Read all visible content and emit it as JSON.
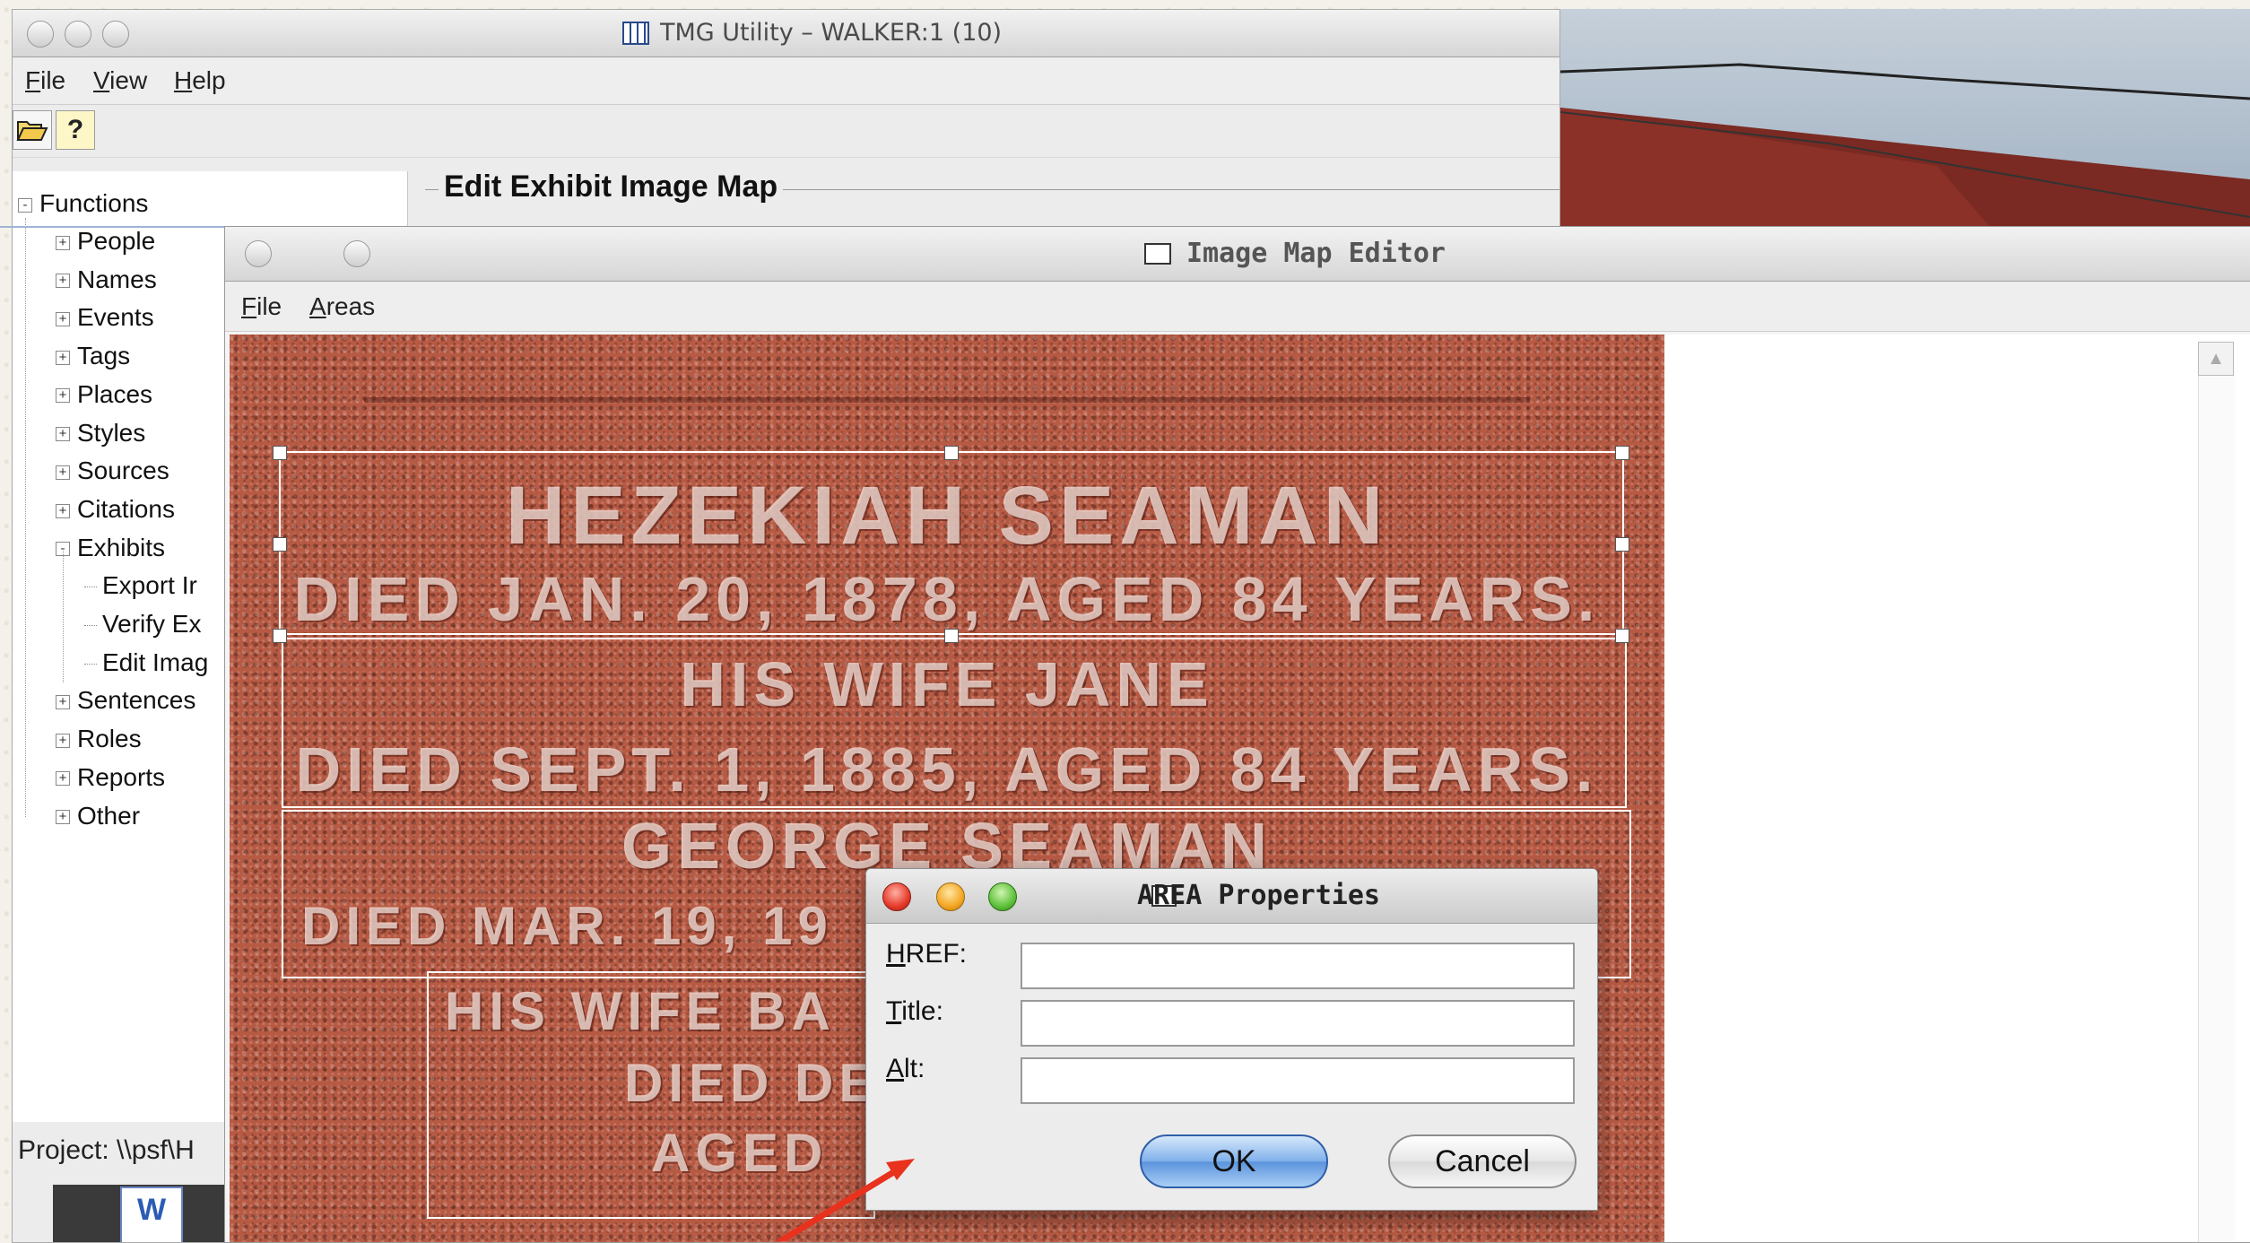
{
  "tmg_window": {
    "title": "TMG Utility – WALKER:1 (10)",
    "menu": [
      "File",
      "View",
      "Help"
    ],
    "menu_underline": [
      "F",
      "V",
      "H"
    ],
    "toolbar_icons": [
      "open-folder-icon",
      "help-icon"
    ]
  },
  "tree": {
    "root": "Functions",
    "items": [
      {
        "label": "People",
        "expander": "+"
      },
      {
        "label": "Names",
        "expander": "+"
      },
      {
        "label": "Events",
        "expander": "+"
      },
      {
        "label": "Tags",
        "expander": "+"
      },
      {
        "label": "Places",
        "expander": "+"
      },
      {
        "label": "Styles",
        "expander": "+"
      },
      {
        "label": "Sources",
        "expander": "+"
      },
      {
        "label": "Citations",
        "expander": "+"
      },
      {
        "label": "Exhibits",
        "expander": "-"
      },
      {
        "label": "Export Ir",
        "expander": ""
      },
      {
        "label": "Verify Ex",
        "expander": ""
      },
      {
        "label": "Edit Imag",
        "expander": ""
      },
      {
        "label": "Sentences",
        "expander": "+"
      },
      {
        "label": "Roles",
        "expander": "+"
      },
      {
        "label": "Reports",
        "expander": "+"
      },
      {
        "label": "Other",
        "expander": "+"
      }
    ],
    "root_expander": "-"
  },
  "project_label": "Project: \\\\psf\\H",
  "group_title": "Edit Exhibit Image Map",
  "image_map_editor": {
    "title": "Image Map Editor",
    "menu": [
      "File",
      "Areas"
    ],
    "menu_underline": [
      "F",
      "A"
    ]
  },
  "inscription": {
    "line1": "HEZEKIAH SEAMAN",
    "line2": "DIED JAN. 20, 1878, AGED 84 YEARS.",
    "line3": "HIS WIFE JANE",
    "line4": "DIED SEPT. 1, 1885, AGED 84 YEARS.",
    "line5": "GEORGE SEAMAN",
    "line6": "DIED MAR. 19, 19",
    "line7": "HIS WIFE BA",
    "line8": "DIED DE",
    "line9": "AGED"
  },
  "area_dialog": {
    "title": "AREA Properties",
    "fields": [
      {
        "label": "HREF:",
        "underline": "H",
        "value": ""
      },
      {
        "label": "Title:",
        "underline": "T",
        "value": ""
      },
      {
        "label": "Alt:",
        "underline": "A",
        "value": ""
      }
    ],
    "ok_label": "OK",
    "cancel_label": "Cancel"
  },
  "colors": {
    "stone": "#b75a44",
    "ok_button": "#6aa3e6",
    "annotation_arrow": "#e8321e"
  }
}
